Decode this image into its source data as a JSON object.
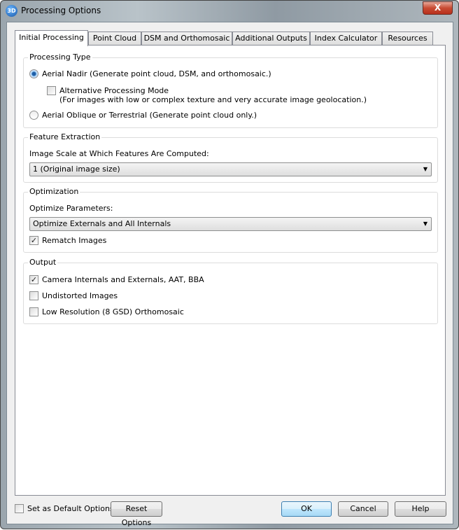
{
  "window": {
    "title": "Processing Options",
    "icon": "3D",
    "close_label": "X"
  },
  "tabs": [
    {
      "label": "Initial Processing",
      "active": true
    },
    {
      "label": "Point Cloud"
    },
    {
      "label": "DSM and Orthomosaic"
    },
    {
      "label": "Additional Outputs"
    },
    {
      "label": "Index Calculator"
    },
    {
      "label": "Resources"
    }
  ],
  "processing_type": {
    "title": "Processing Type",
    "aerial_nadir": {
      "label": "Aerial Nadir (Generate point cloud, DSM, and orthomosaic.)",
      "selected": true
    },
    "alt_mode": {
      "label": "Alternative Processing Mode",
      "note": "(For images with low or complex texture and very accurate image geolocation.)",
      "checked": false
    },
    "oblique": {
      "label": "Aerial Oblique or Terrestrial (Generate point cloud only.)",
      "selected": false
    }
  },
  "feature_extraction": {
    "title": "Feature Extraction",
    "label": "Image Scale at Which Features Are Computed:",
    "value": "1 (Original image size)"
  },
  "optimization": {
    "title": "Optimization",
    "label": "Optimize Parameters:",
    "value": "Optimize Externals and All Internals",
    "rematch": {
      "label": "Rematch Images",
      "checked": true
    }
  },
  "output": {
    "title": "Output",
    "items": [
      {
        "label": "Camera Internals and Externals, AAT, BBA",
        "checked": true
      },
      {
        "label": "Undistorted Images",
        "checked": false
      },
      {
        "label": "Low Resolution (8 GSD) Orthomosaic",
        "checked": false
      }
    ]
  },
  "footer": {
    "default_label": "Set as Default Options",
    "default_checked": false,
    "reset": "Reset Options",
    "ok": "OK",
    "cancel": "Cancel",
    "help": "Help"
  }
}
